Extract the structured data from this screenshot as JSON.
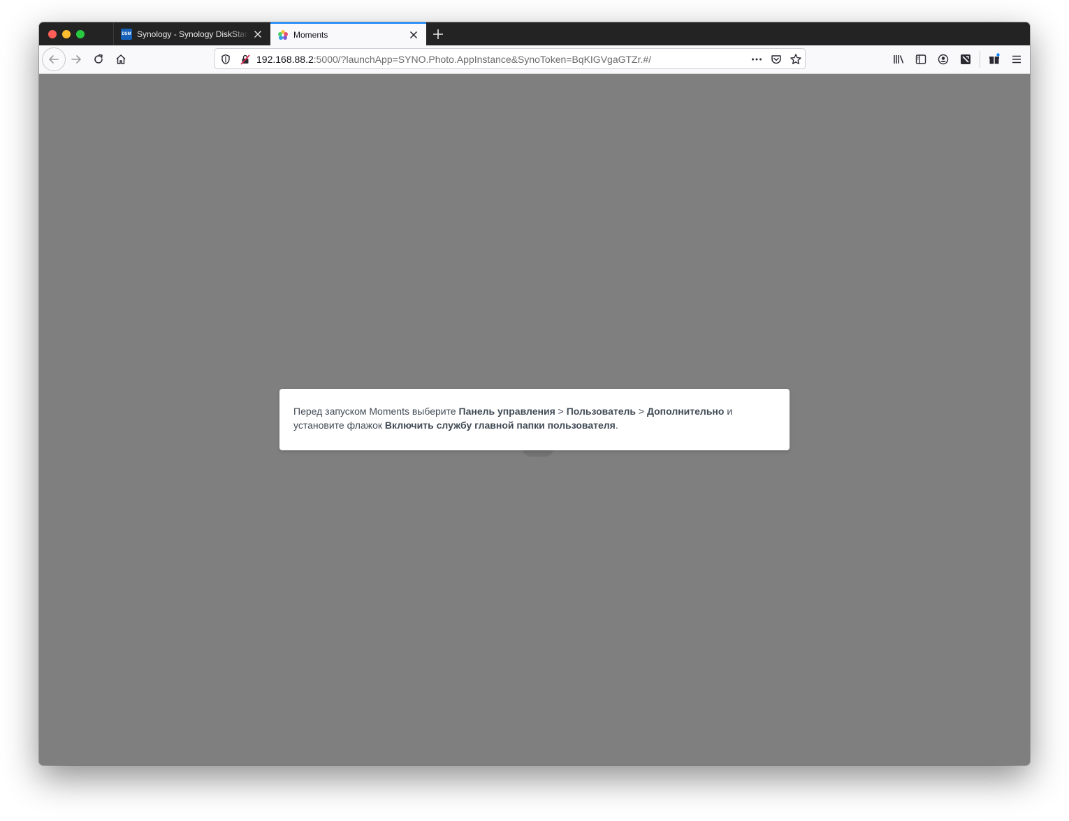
{
  "browser": {
    "tabs": [
      {
        "label": "Synology - Synology DiskStation",
        "favicon": "dsm-icon",
        "favicon_text": "DSM",
        "active": false
      },
      {
        "label": "Moments",
        "favicon": "moments-icon",
        "active": true
      }
    ],
    "url": {
      "host": "192.168.88.2",
      "rest": ":5000/?launchApp=SYNO.Photo.AppInstance&SynoToken=BqKIGVgaGTZr.#/"
    },
    "urlbar_icons": [
      "shield-icon",
      "insecure-lock-icon",
      "page-actions-icon",
      "pocket-icon",
      "bookmark-star-icon"
    ],
    "toolbar_icons": [
      "library-icon",
      "sidebar-icon",
      "account-icon",
      "extension-icon",
      "whats-new-icon",
      "menu-icon"
    ]
  },
  "dialog": {
    "text1": "Перед запуском Moments выберите ",
    "b1": "Панель управления",
    "sep1": " > ",
    "b2": "Пользователь",
    "sep2": " > ",
    "b3": "Дополнительно",
    "text2": " и установите флажок ",
    "b4": "Включить службу главной папки пользователя",
    "text3": "."
  },
  "colors": {
    "tabstrip_bg": "#232323",
    "active_tab_accent": "#0a84ff",
    "content_overlay": "#7f7f7f",
    "dialog_text": "#414b55"
  }
}
